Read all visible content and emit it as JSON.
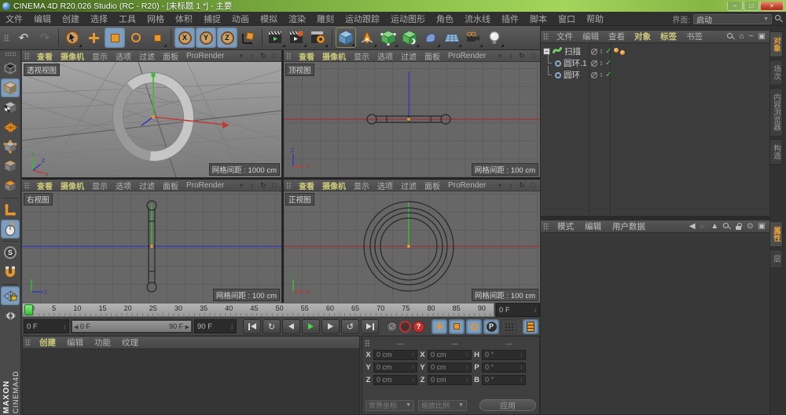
{
  "window": {
    "title": "CINEMA 4D R20.026 Studio (RC - R20) - [未标题 1 *] - 主要"
  },
  "menubar": {
    "items": [
      "文件",
      "编辑",
      "创建",
      "选择",
      "工具",
      "网格",
      "体积",
      "捕捉",
      "动画",
      "模拟",
      "渲染",
      "雕刻",
      "运动跟踪",
      "运动图形",
      "角色",
      "流水线",
      "插件",
      "脚本",
      "窗口",
      "帮助"
    ],
    "interface_label": "界面:",
    "interface_value": "启动"
  },
  "toolbar": {
    "axis_labels": [
      "X",
      "Y",
      "Z"
    ]
  },
  "viewport_menu": [
    "查看",
    "摄像机",
    "显示",
    "选项",
    "过滤",
    "面板",
    "ProRender"
  ],
  "viewports": [
    {
      "label": "透视视图",
      "grid_label": "网格间距 : 1000 cm"
    },
    {
      "label": "顶视图",
      "grid_label": "网格间距 : 100 cm"
    },
    {
      "label": "右视图",
      "grid_label": "网格间距 : 100 cm"
    },
    {
      "label": "正视图",
      "grid_label": "网格间距 : 100 cm"
    }
  ],
  "object_manager": {
    "menu": [
      "文件",
      "编辑",
      "查看",
      "对象",
      "标签",
      "书签"
    ],
    "items": [
      {
        "name": "扫描"
      },
      {
        "name": "圆环.1"
      },
      {
        "name": "圆环"
      }
    ]
  },
  "attribute_manager": {
    "menu": [
      "模式",
      "编辑",
      "用户数据"
    ]
  },
  "side_tabs": {
    "top": [
      "对象",
      "场次",
      "内容浏览器",
      "构造"
    ],
    "bottom": [
      "属性",
      "层"
    ]
  },
  "material_manager": {
    "menu": [
      "创建",
      "编辑",
      "功能",
      "纹理"
    ]
  },
  "timeline": {
    "ticks": [
      "0",
      "5",
      "10",
      "15",
      "20",
      "25",
      "30",
      "35",
      "40",
      "45",
      "50",
      "55",
      "60",
      "65",
      "70",
      "75",
      "80",
      "85",
      "90"
    ],
    "frame_field": "0 F",
    "current_frame": "0 F",
    "range_start": "0 F",
    "range_end": "90 F",
    "end_frame": "90 F"
  },
  "coordinates": {
    "col_headers": [
      "—",
      "—",
      "—"
    ],
    "rows": [
      {
        "a": "X",
        "av": "0 cm",
        "b": "X",
        "bv": "0 cm",
        "c": "H",
        "cv": "0 °"
      },
      {
        "a": "Y",
        "av": "0 cm",
        "b": "Y",
        "bv": "0 cm",
        "c": "P",
        "cv": "0 °"
      },
      {
        "a": "Z",
        "av": "0 cm",
        "b": "Z",
        "bv": "0 cm",
        "c": "B",
        "cv": "0 °"
      }
    ],
    "world_dropdown": "世界坐标",
    "scale_dropdown": "缩放比例",
    "apply_label": "应用"
  },
  "branding": {
    "line1": "MAXON",
    "line2": "CINEMA4D"
  },
  "colors": {
    "accent_orange": "#e8962e",
    "highlight_blue": "#7d9ec0",
    "check_green": "#52c752",
    "axis_x": "#c23a3a",
    "axis_y": "#3cb83c",
    "axis_z": "#3a3ab8",
    "play_green": "#46d846",
    "record_red": "#c23232",
    "active_tab_orange": "#e8a33d"
  },
  "icons": {
    "undo": "↶",
    "redo": "↷",
    "pan": "+",
    "zoom": "↕",
    "rotate": "↻",
    "maximize": "□",
    "dropdown_arrow": "▼",
    "stepper": "↕",
    "back": "◀",
    "forward": "▶",
    "up": "▲",
    "check": "✓",
    "minus": "−",
    "home": "⌂",
    "frame_all": "▣",
    "settings": "⊙",
    "collapse": "−",
    "loop_cw": "↻",
    "loop_ccw": "↺",
    "prev_frame": "◀",
    "next_frame": "▶",
    "range_left": "◀",
    "range_right": "▶",
    "param_key": "P",
    "question": "?",
    "win_min": "−",
    "win_max": "□",
    "win_close": "×"
  }
}
